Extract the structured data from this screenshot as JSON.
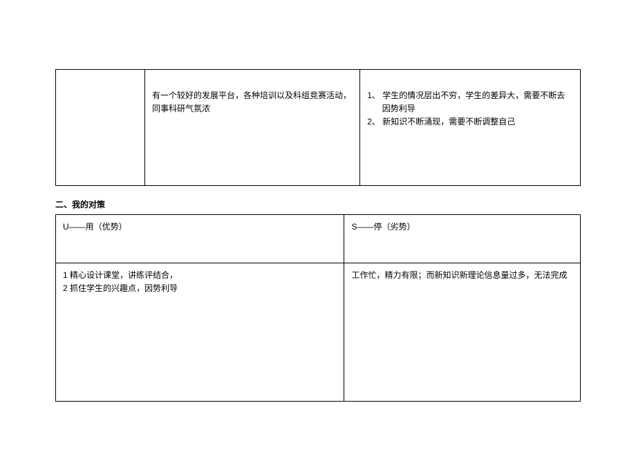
{
  "table1": {
    "opportunity_text": "有一个较好的发展平台，各种培训以及科组竞赛活动，同事科研气氛浓",
    "threat_item1": "1、 学生的情况层出不穷，学生的差异大，需要不断去因势利导",
    "threat_item2": "2、 新知识不断涌现，需要不断调整自己"
  },
  "section2_heading": "二、我的对策",
  "table2": {
    "header_left": "U——用（优势）",
    "header_right": "S——停（劣势）",
    "body_left_line1": "1 精心设计课堂，讲练评结合，",
    "body_left_line2": "2 抓住学生的兴趣点，因势利导",
    "body_right": "工作忙，精力有限；而新知识新理论信息量过多，无法完成"
  }
}
